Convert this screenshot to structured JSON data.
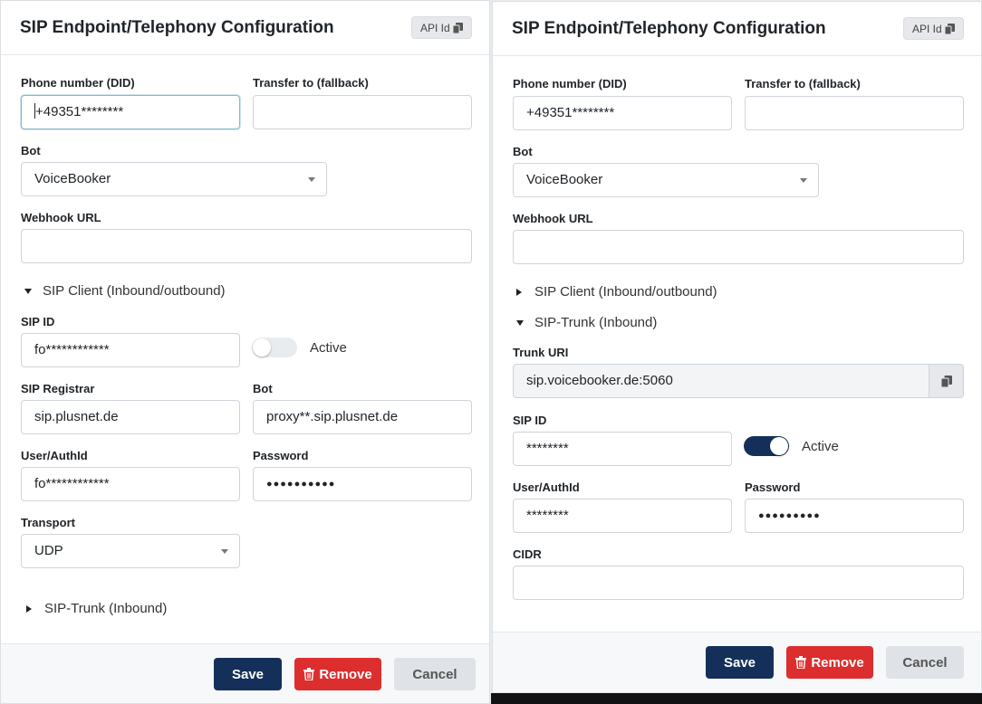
{
  "left": {
    "title": "SIP Endpoint/Telephony Configuration",
    "api_label": "API Id",
    "phone_label": "Phone number (DID)",
    "phone_value": "+49351********",
    "transfer_label": "Transfer to (fallback)",
    "transfer_value": "",
    "bot_label": "Bot",
    "bot_value": "VoiceBooker",
    "webhook_label": "Webhook URL",
    "webhook_value": "",
    "sip_client_section": "SIP Client (Inbound/outbound)",
    "sip_id_label": "SIP ID",
    "sip_id_value": "fo************",
    "active_label": "Active",
    "active_on": false,
    "registrar_label": "SIP Registrar",
    "registrar_value": "sip.plusnet.de",
    "proxy_label": "Bot",
    "proxy_value": "proxy**.sip.plusnet.de",
    "user_label": "User/AuthId",
    "user_value": "fo************",
    "password_label": "Password",
    "password_value": "●●●●●●●●●●",
    "transport_label": "Transport",
    "transport_value": "UDP",
    "sip_trunk_section": "SIP-Trunk (Inbound)",
    "save_label": "Save",
    "remove_label": "Remove",
    "cancel_label": "Cancel"
  },
  "right": {
    "title": "SIP Endpoint/Telephony Configuration",
    "api_label": "API Id",
    "phone_label": "Phone number (DID)",
    "phone_value": "+49351********",
    "transfer_label": "Transfer to (fallback)",
    "transfer_value": "",
    "bot_label": "Bot",
    "bot_value": "VoiceBooker",
    "webhook_label": "Webhook URL",
    "webhook_value": "",
    "sip_client_section": "SIP Client (Inbound/outbound)",
    "sip_trunk_section": "SIP-Trunk (Inbound)",
    "trunk_uri_label": "Trunk URI",
    "trunk_uri_value": "sip.voicebooker.de:5060",
    "sip_id_label": "SIP ID",
    "sip_id_value": "********",
    "active_label": "Active",
    "active_on": true,
    "user_label": "User/AuthId",
    "user_value": "********",
    "password_label": "Password",
    "password_value": "●●●●●●●●●",
    "cidr_label": "CIDR",
    "cidr_value": "",
    "save_label": "Save",
    "remove_label": "Remove",
    "cancel_label": "Cancel"
  },
  "colors": {
    "primary": "#14305a",
    "danger": "#dc2e2e",
    "neutral_button": "#dfe2e6"
  }
}
